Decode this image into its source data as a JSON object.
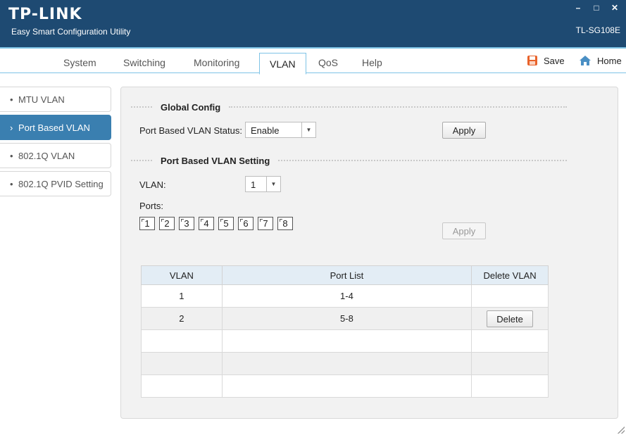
{
  "app": {
    "logo": "TP-LINK",
    "subtitle": "Easy Smart Configuration Utility",
    "model": "TL-SG108E",
    "window_controls": [
      "–",
      "□",
      "✕"
    ]
  },
  "nav": {
    "tabs": [
      "System",
      "Switching",
      "Monitoring",
      "VLAN",
      "QoS",
      "Help"
    ],
    "active_tab": "VLAN",
    "save_label": "Save",
    "home_label": "Home"
  },
  "sidebar": {
    "items": [
      {
        "label": "MTU VLAN",
        "bullet": "•"
      },
      {
        "label": "Port Based VLAN",
        "bullet": "›"
      },
      {
        "label": "802.1Q VLAN",
        "bullet": "•"
      },
      {
        "label": "802.1Q PVID Setting",
        "bullet": "•"
      }
    ],
    "active_index": 1
  },
  "global_config": {
    "title": "Global Config",
    "status_label": "Port Based VLAN Status:",
    "status_value": "Enable",
    "apply_label": "Apply"
  },
  "vlan_setting": {
    "title": "Port Based VLAN Setting",
    "vlan_label": "VLAN:",
    "vlan_value": "1",
    "ports_label": "Ports:",
    "ports": [
      "1",
      "2",
      "3",
      "4",
      "5",
      "6",
      "7",
      "8"
    ],
    "apply_label": "Apply"
  },
  "table": {
    "headers": [
      "VLAN",
      "Port List",
      "Delete VLAN"
    ],
    "rows": [
      {
        "vlan": "1",
        "ports": "1-4",
        "action": ""
      },
      {
        "vlan": "2",
        "ports": "5-8",
        "action": "Delete"
      },
      {
        "vlan": "",
        "ports": "",
        "action": ""
      },
      {
        "vlan": "",
        "ports": "",
        "action": ""
      },
      {
        "vlan": "",
        "ports": "",
        "action": ""
      }
    ]
  },
  "colors": {
    "titlebar": "#1e4a72",
    "accent": "#3a7fb0",
    "nav_border": "#7ec3e6",
    "save_icon": "#e8622a",
    "home_icon": "#4a8fc4"
  }
}
